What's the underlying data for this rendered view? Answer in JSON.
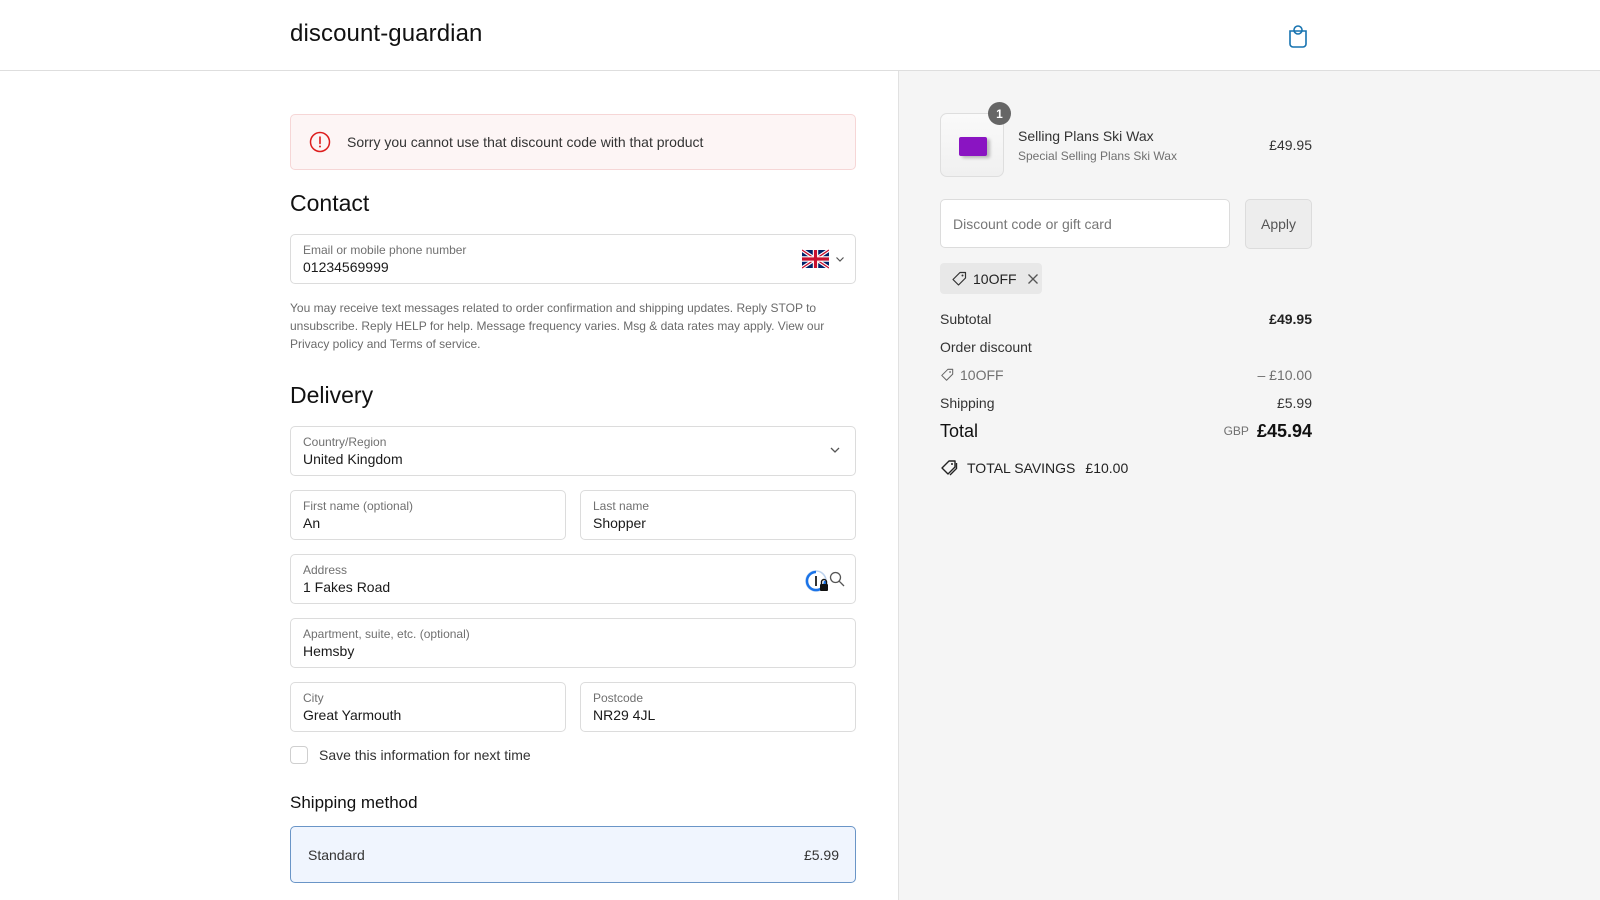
{
  "header": {
    "shop_name": "discount-guardian",
    "cart_icon": "shopping-bag-icon"
  },
  "alert": {
    "icon": "error-circle-icon",
    "message": "Sorry you cannot use that discount code with that product"
  },
  "contact": {
    "title": "Contact",
    "field_label": "Email or mobile phone number",
    "field_value": "01234569999",
    "country_flag": "uk-flag-icon",
    "sms_note": "You may receive text messages related to order confirmation and shipping updates. Reply STOP to unsubscribe. Reply HELP for help. Message frequency varies. Msg & data rates may apply. View our Privacy policy and Terms of service."
  },
  "delivery": {
    "title": "Delivery",
    "country": {
      "label": "Country/Region",
      "value": "United Kingdom"
    },
    "first_name": {
      "label": "First name (optional)",
      "value": "An"
    },
    "last_name": {
      "label": "Last name",
      "value": "Shopper"
    },
    "address": {
      "label": "Address",
      "value": "1 Fakes Road"
    },
    "apartment": {
      "label": "Apartment, suite, etc. (optional)",
      "value": "Hemsby"
    },
    "city": {
      "label": "City",
      "value": "Great Yarmouth"
    },
    "postcode": {
      "label": "Postcode",
      "value": "NR29 4JL"
    },
    "save_info_label": "Save this information for next time",
    "save_info_checked": false
  },
  "shipping_method": {
    "title": "Shipping method",
    "option": {
      "name": "Standard",
      "price": "£5.99",
      "selected": true
    }
  },
  "summary": {
    "product": {
      "quantity": "1",
      "title": "Selling Plans Ski Wax",
      "subtitle": "Special Selling Plans Ski Wax",
      "price": "£49.95"
    },
    "discount_placeholder": "Discount code or gift card",
    "discount_value": "",
    "apply_label": "Apply",
    "applied_code": "10OFF",
    "subtotal_label": "Subtotal",
    "subtotal_value": "£49.95",
    "order_discount_label": "Order discount",
    "discount_code_label": "10OFF",
    "discount_amount": "– £10.00",
    "shipping_label": "Shipping",
    "shipping_value": "£5.99",
    "total_label": "Total",
    "currency": "GBP",
    "total_value": "£45.94",
    "savings_label": "TOTAL SAVINGS",
    "savings_value": "£10.00"
  },
  "colors": {
    "accent": "#1773b0",
    "error": "#dd1d1d",
    "selected_option_bg": "#f0f5fe",
    "product_color": "#8a14c2"
  }
}
